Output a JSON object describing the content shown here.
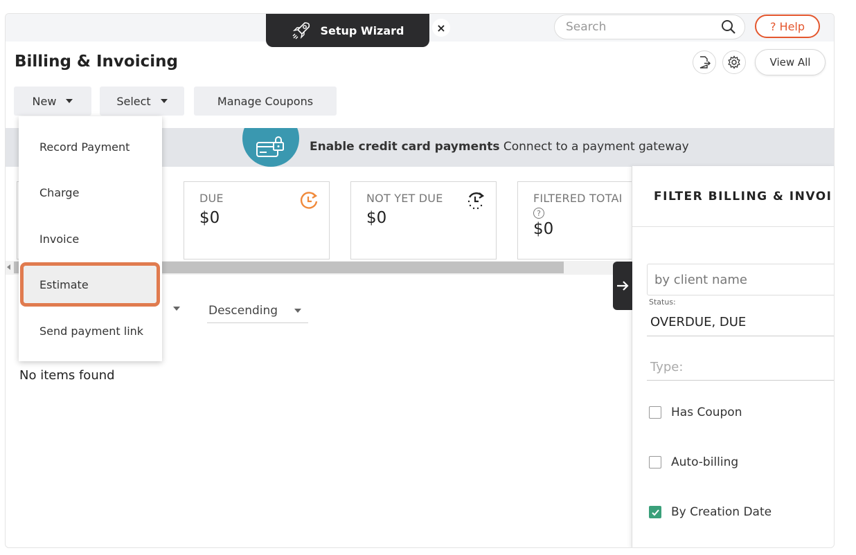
{
  "topbar": {
    "wizard_label": "Setup Wizard",
    "wizard_close": "×",
    "search_placeholder": "Search",
    "help_label": "? Help"
  },
  "header": {
    "title": "Billing & Invoicing",
    "view_all_label": "View All"
  },
  "toolbar": {
    "new_label": "New",
    "select_label": "Select",
    "coupons_label": "Manage Coupons"
  },
  "new_menu": {
    "items": [
      "Record Payment",
      "Charge",
      "Invoice",
      "Estimate",
      "Send payment link"
    ],
    "highlighted": "Estimate"
  },
  "banner": {
    "bold": "Enable credit card payments",
    "text": "Connect to a payment gateway"
  },
  "stats": [
    {
      "label": "DUE",
      "value": "$0",
      "icon": "clock-refresh-icon",
      "icon_color": "#f0893a"
    },
    {
      "label": "NOT YET DUE",
      "value": "$0",
      "icon": "clock-pending-icon",
      "icon_color": "#222222"
    },
    {
      "label": "FILTERED TOTAI",
      "value": "$0",
      "help": "?"
    }
  ],
  "list": {
    "sort_order": "Descending",
    "empty_text": "No items found"
  },
  "filter": {
    "title": "FILTER BILLING & INVOI",
    "client_placeholder": "by client name",
    "status_label": "Status:",
    "status_value": "OVERDUE, DUE",
    "type_placeholder": "Type:",
    "checkboxes": [
      {
        "label": "Has Coupon",
        "checked": false
      },
      {
        "label": "Auto-billing",
        "checked": false
      },
      {
        "label": "By Creation Date",
        "checked": true
      }
    ]
  },
  "colors": {
    "accent_orange": "#e07b4f",
    "help_red": "#e4572e",
    "banner_teal": "#3a98b0",
    "check_green": "#3aa07a"
  }
}
